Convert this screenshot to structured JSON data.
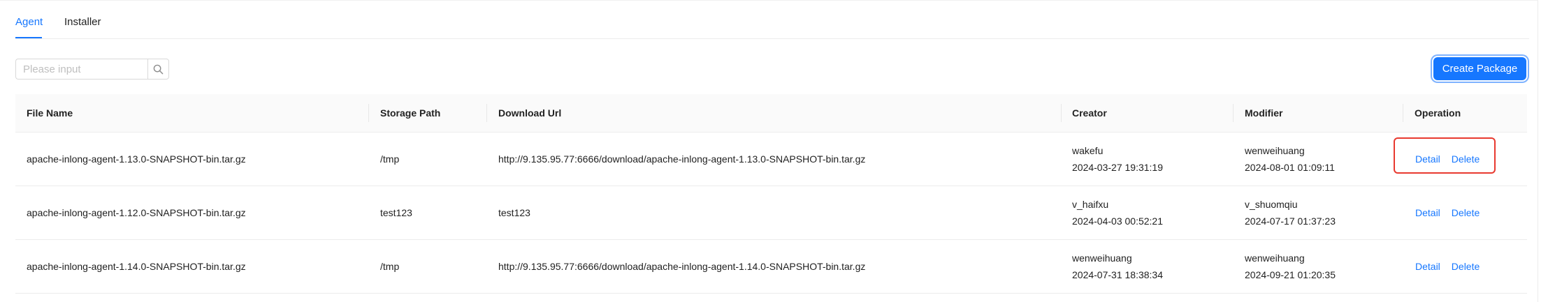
{
  "tabs": [
    {
      "label": "Agent",
      "active": true
    },
    {
      "label": "Installer",
      "active": false
    }
  ],
  "search": {
    "placeholder": "Please input",
    "value": ""
  },
  "create_button": {
    "label": "Create Package"
  },
  "table": {
    "columns": [
      "File Name",
      "Storage Path",
      "Download Url",
      "Creator",
      "Modifier",
      "Operation"
    ],
    "rows": [
      {
        "file_name": "apache-inlong-agent-1.13.0-SNAPSHOT-bin.tar.gz",
        "storage_path": "/tmp",
        "download_url": "http://9.135.95.77:6666/download/apache-inlong-agent-1.13.0-SNAPSHOT-bin.tar.gz",
        "creator": "wakefu",
        "created_at": "2024-03-27 19:31:19",
        "modifier": "wenweihuang",
        "modified_at": "2024-08-01 01:09:11",
        "ops": [
          "Detail",
          "Delete"
        ]
      },
      {
        "file_name": "apache-inlong-agent-1.12.0-SNAPSHOT-bin.tar.gz",
        "storage_path": "test123",
        "download_url": "test123",
        "creator": "v_haifxu",
        "created_at": "2024-04-03 00:52:21",
        "modifier": "v_shuomqiu",
        "modified_at": "2024-07-17 01:37:23",
        "ops": [
          "Detail",
          "Delete"
        ]
      },
      {
        "file_name": "apache-inlong-agent-1.14.0-SNAPSHOT-bin.tar.gz",
        "storage_path": "/tmp",
        "download_url": "http://9.135.95.77:6666/download/apache-inlong-agent-1.14.0-SNAPSHOT-bin.tar.gz",
        "creator": "wenweihuang",
        "created_at": "2024-07-31 18:38:34",
        "modifier": "wenweihuang",
        "modified_at": "2024-09-21 01:20:35",
        "ops": [
          "Detail",
          "Delete"
        ]
      }
    ]
  },
  "colors": {
    "accent": "#1677ff",
    "highlight_border": "#e8392f"
  },
  "icons": {
    "search": "search-icon"
  }
}
